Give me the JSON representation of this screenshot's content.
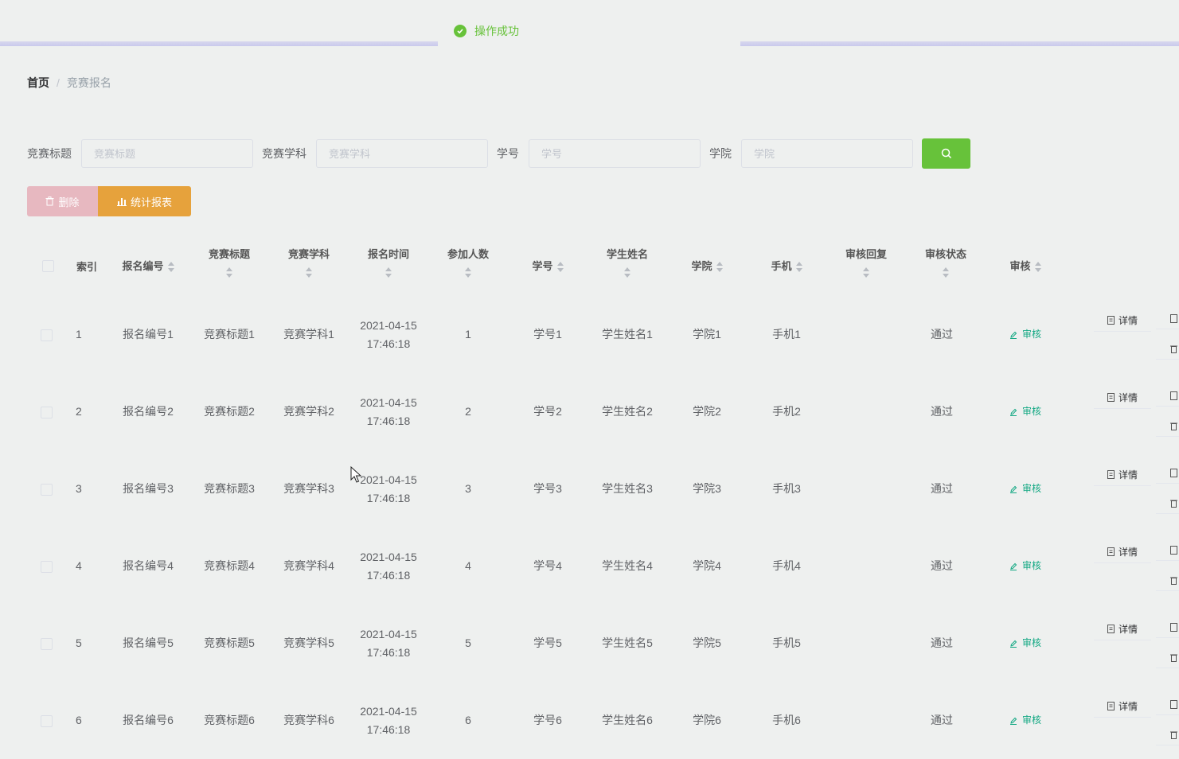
{
  "toast": {
    "message": "操作成功",
    "color": "#67c23a"
  },
  "breadcrumb": {
    "home": "首页",
    "separator": "/",
    "current": "竞赛报名"
  },
  "search": {
    "fields": [
      {
        "label": "竞赛标题",
        "placeholder": "竞赛标题",
        "value": ""
      },
      {
        "label": "竞赛学科",
        "placeholder": "竞赛学科",
        "value": ""
      },
      {
        "label": "学号",
        "placeholder": "学号",
        "value": ""
      },
      {
        "label": "学院",
        "placeholder": "学院",
        "value": ""
      }
    ],
    "button_icon": "search-icon"
  },
  "toolbar": {
    "delete_label": "删除",
    "report_label": "统计报表"
  },
  "table": {
    "columns": {
      "index": "索引",
      "regno": "报名编号",
      "title": "竞赛标题",
      "subject": "竞赛学科",
      "time": "报名时间",
      "count": "参加人数",
      "sid": "学号",
      "name": "学生姓名",
      "college": "学院",
      "phone": "手机",
      "reply": "审核回复",
      "status": "审核状态",
      "audit": "审核"
    },
    "audit_label": "审核",
    "detail_label": "详情",
    "rows": [
      {
        "index": "1",
        "regno": "报名编号1",
        "title": "竞赛标题1",
        "subject": "竞赛学科1",
        "date": "2021-04-15",
        "clock": "17:46:18",
        "count": "1",
        "sid": "学号1",
        "name": "学生姓名1",
        "college": "学院1",
        "phone": "手机1",
        "reply": "",
        "status": "通过"
      },
      {
        "index": "2",
        "regno": "报名编号2",
        "title": "竞赛标题2",
        "subject": "竞赛学科2",
        "date": "2021-04-15",
        "clock": "17:46:18",
        "count": "2",
        "sid": "学号2",
        "name": "学生姓名2",
        "college": "学院2",
        "phone": "手机2",
        "reply": "",
        "status": "通过"
      },
      {
        "index": "3",
        "regno": "报名编号3",
        "title": "竞赛标题3",
        "subject": "竞赛学科3",
        "date": "2021-04-15",
        "clock": "17:46:18",
        "count": "3",
        "sid": "学号3",
        "name": "学生姓名3",
        "college": "学院3",
        "phone": "手机3",
        "reply": "",
        "status": "通过"
      },
      {
        "index": "4",
        "regno": "报名编号4",
        "title": "竞赛标题4",
        "subject": "竞赛学科4",
        "date": "2021-04-15",
        "clock": "17:46:18",
        "count": "4",
        "sid": "学号4",
        "name": "学生姓名4",
        "college": "学院4",
        "phone": "手机4",
        "reply": "",
        "status": "通过"
      },
      {
        "index": "5",
        "regno": "报名编号5",
        "title": "竞赛标题5",
        "subject": "竞赛学科5",
        "date": "2021-04-15",
        "clock": "17:46:18",
        "count": "5",
        "sid": "学号5",
        "name": "学生姓名5",
        "college": "学院5",
        "phone": "手机5",
        "reply": "",
        "status": "通过"
      },
      {
        "index": "6",
        "regno": "报名编号6",
        "title": "竞赛标题6",
        "subject": "竞赛学科6",
        "date": "2021-04-15",
        "clock": "17:46:18",
        "count": "6",
        "sid": "学号6",
        "name": "学生姓名6",
        "college": "学院6",
        "phone": "手机6",
        "reply": "",
        "status": "通过"
      }
    ]
  },
  "colors": {
    "primary_green": "#67c23a",
    "warning": "#e6a23c",
    "danger_disabled": "#e7b8c0",
    "audit_link": "#13a883"
  }
}
